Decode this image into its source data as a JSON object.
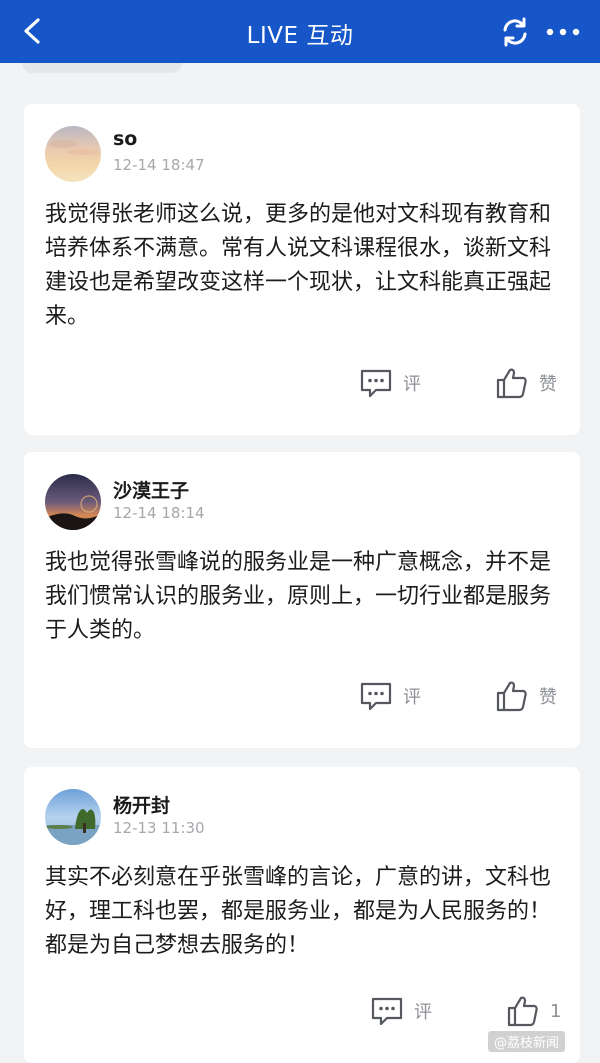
{
  "header": {
    "title": "LIVE 互动",
    "back_icon": "back-arrow-icon",
    "refresh_icon": "refresh-icon",
    "more_icon": "more-dots-icon",
    "background": "#1656c9"
  },
  "comments": [
    {
      "author": "so",
      "time": "12-14 18:47",
      "text": "我觉得张老师这么说，更多的是他对文科现有教育和培养体系不满意。常有人说文科课程很水，谈新文科建设也是希望改变这样一个现状，让文科能真正强起来。",
      "reply_label": "评",
      "like_label": "赞"
    },
    {
      "author": "沙漠王子",
      "time": "12-14 18:14",
      "text": "我也觉得张雪峰说的服务业是一种广意概念，并不是我们惯常认识的服务业，原则上，一切行业都是服务于人类的。",
      "reply_label": "评",
      "like_label": "赞"
    },
    {
      "author": "杨开封",
      "time": "12-13 11:30",
      "text": "其实不必刻意在乎张雪峰的言论，广意的讲，文科也好，理工科也罢，都是服务业，都是为人民服务的！都是为自己梦想去服务的！",
      "reply_label": "评",
      "like_label": "1"
    }
  ],
  "watermark": "@荔枝新闻"
}
